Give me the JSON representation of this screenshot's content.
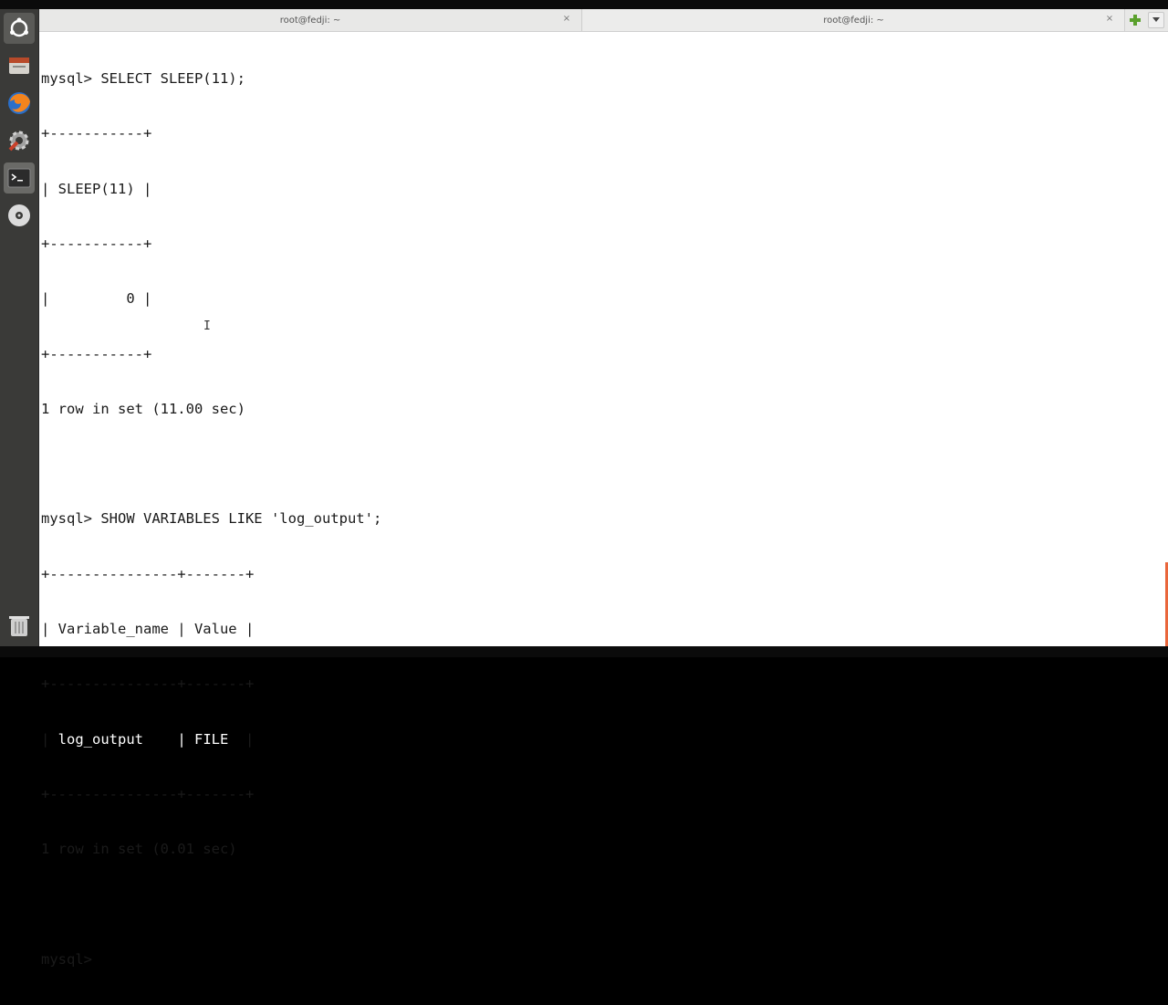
{
  "window": {
    "tabs": [
      {
        "title": "root@fedji: ~",
        "close": "×"
      },
      {
        "title": "root@fedji: ~",
        "close": "×"
      }
    ]
  },
  "launcher": {
    "items": [
      "ubuntu-logo-icon",
      "files-icon",
      "firefox-icon",
      "system-settings-icon",
      "terminal-icon",
      "dvd-icon",
      "trash-icon"
    ]
  },
  "terminal": {
    "lines": [
      "mysql> SELECT SLEEP(11);",
      "+-----------+",
      "| SLEEP(11) |",
      "+-----------+",
      "|         0 |",
      "+-----------+",
      "1 row in set (11.00 sec)",
      "",
      "mysql> SHOW VARIABLES LIKE 'log_output';",
      "+---------------+-------+",
      "| Variable_name | Value |",
      "+---------------+-------+",
      "",
      "+---------------+-------+",
      "1 row in set (0.01 sec)",
      "",
      "mysql> "
    ],
    "selected_row": {
      "prefix": "| ",
      "cell1": "log_output   ",
      "sep": " | ",
      "cell2": "FILE ",
      "suffix": " |"
    },
    "prompt": "mysql> "
  }
}
